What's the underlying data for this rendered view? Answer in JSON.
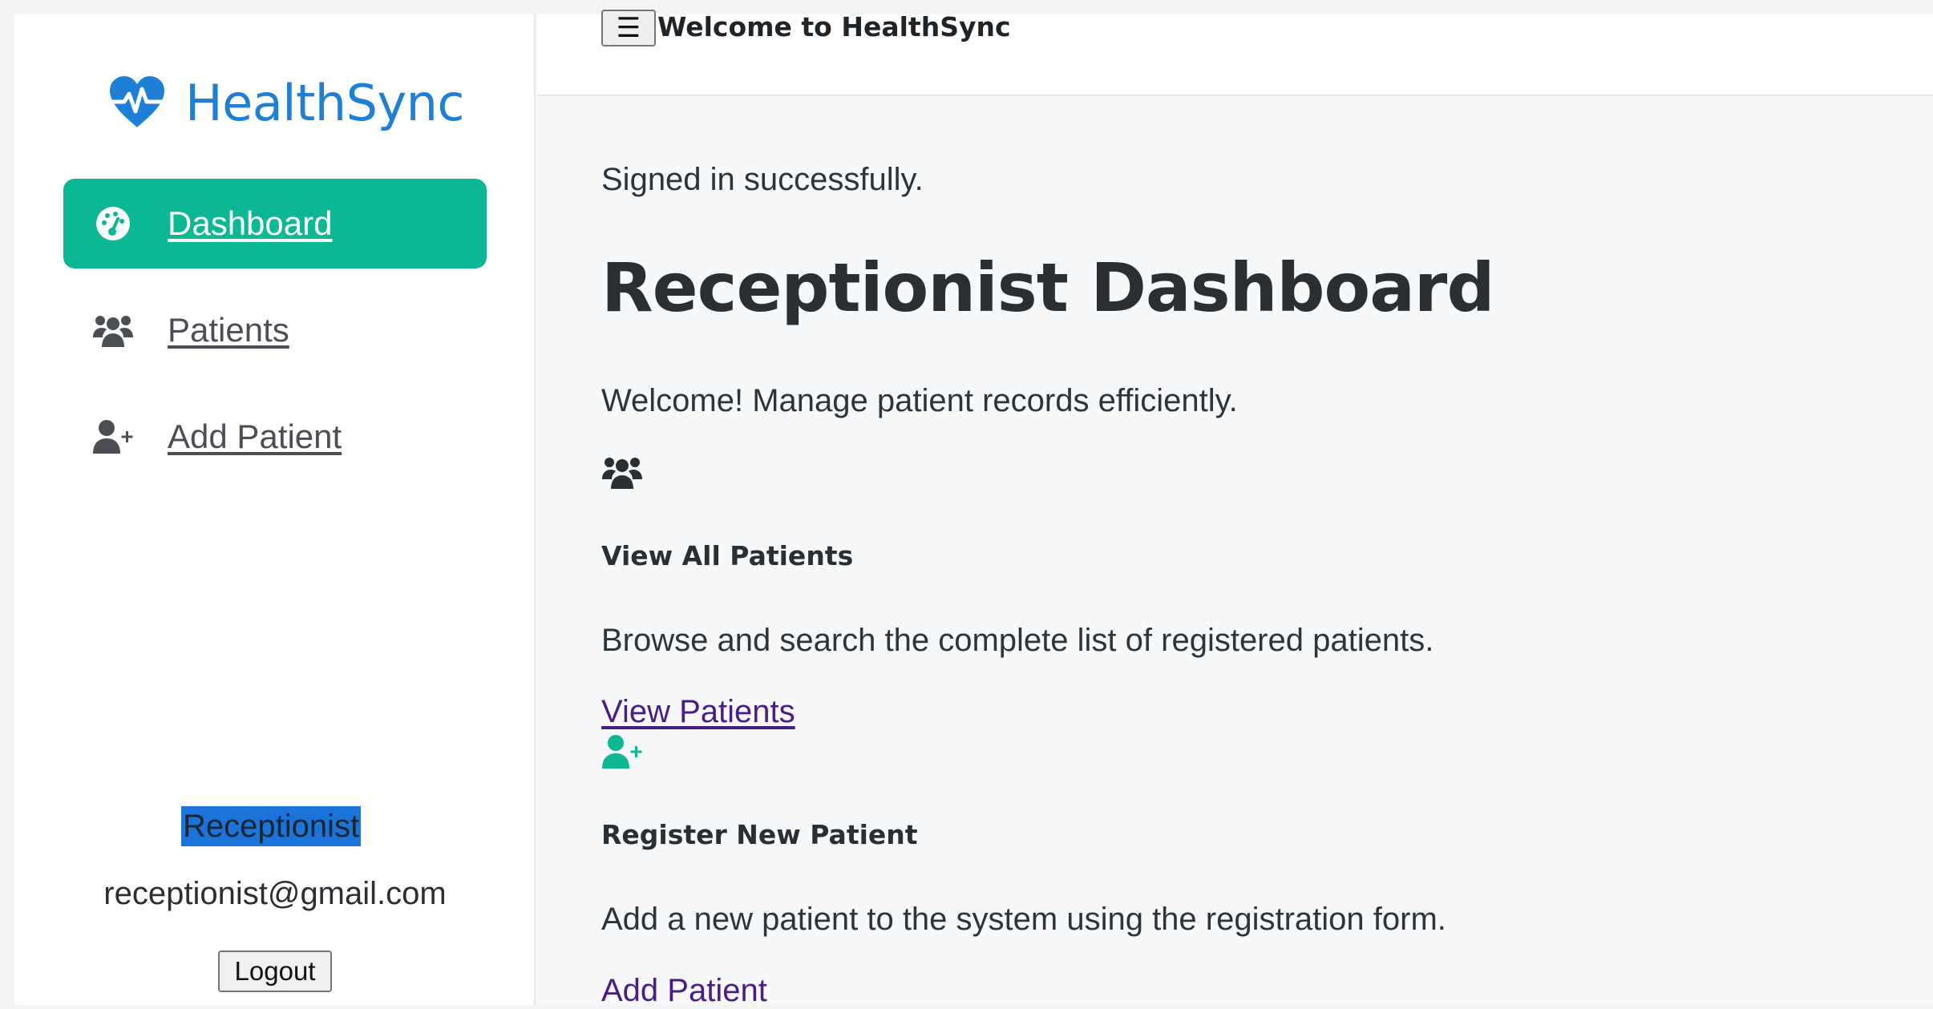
{
  "app": {
    "name": "HealthSync",
    "brand_color": "#1e7fd6",
    "accent_color": "#0cb893"
  },
  "sidebar": {
    "items": [
      {
        "label": "Dashboard",
        "icon": "gauge-icon",
        "active": true
      },
      {
        "label": "Patients",
        "icon": "users-icon",
        "active": false
      },
      {
        "label": "Add Patient",
        "icon": "user-plus-icon",
        "active": false
      }
    ],
    "user": {
      "role": "Receptionist",
      "email": "receptionist@gmail.com",
      "logout_label": "Logout"
    }
  },
  "header": {
    "menu_icon": "☰",
    "title": "Welcome to HealthSync"
  },
  "main": {
    "flash": "Signed in successfully.",
    "title": "Receptionist Dashboard",
    "welcome": "Welcome! Manage patient records efficiently.",
    "cards": [
      {
        "icon": "users-icon",
        "title": "View All Patients",
        "description": "Browse and search the complete list of registered patients.",
        "link": "View Patients",
        "icon_color": "#2a2f33"
      },
      {
        "icon": "user-plus-icon",
        "title": "Register New Patient",
        "description": "Add a new patient to the system using the registration form.",
        "link": "Add Patient",
        "icon_color": "#0cb893"
      }
    ]
  }
}
